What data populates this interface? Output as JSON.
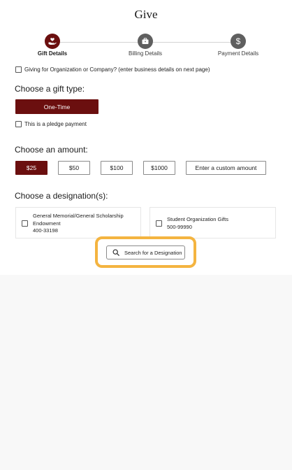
{
  "page": {
    "title": "Give"
  },
  "steps": [
    {
      "label": "Gift Details",
      "icon": "hand-heart-icon",
      "active": true
    },
    {
      "label": "Billing Details",
      "icon": "briefcase-icon",
      "active": false
    },
    {
      "label": "Payment Details",
      "icon": "dollar-icon",
      "active": false
    }
  ],
  "organization": {
    "label": "Giving for Organization or Company? (enter business details on next page)"
  },
  "gift_type": {
    "heading": "Choose a gift type:",
    "selected_option": "One-Time",
    "pledge_label": "This is a pledge payment"
  },
  "amount": {
    "heading": "Choose an amount:",
    "options": [
      "$25",
      "$50",
      "$100",
      "$1000"
    ],
    "selected": "$25",
    "custom_label": "Enter a custom amount"
  },
  "designation": {
    "heading": "Choose a designation(s):",
    "items": [
      {
        "name_line1": "General Memorial/General Scholarship",
        "name_line2": "Endowment",
        "code": "400-33198"
      },
      {
        "name_line1": "Student Organization Gifts",
        "code": "500-99990"
      }
    ],
    "search_label": "Search for a Designation"
  },
  "colors": {
    "brand": "#6b0f0f",
    "highlight": "#f4b440",
    "inactive_step": "#5f5f5f"
  }
}
